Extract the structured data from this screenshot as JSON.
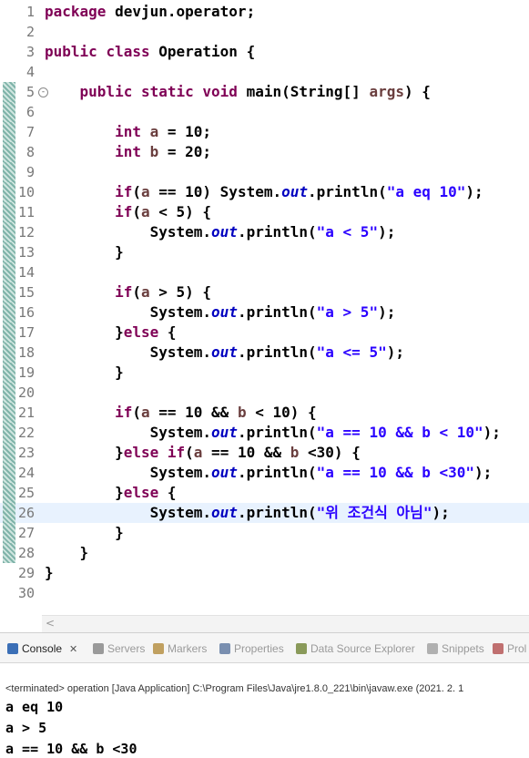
{
  "editor": {
    "lines": [
      {
        "n": "1",
        "html": "<span class='kw'>package</span> devjun.operator;"
      },
      {
        "n": "2",
        "html": ""
      },
      {
        "n": "3",
        "html": "<span class='kw'>public</span> <span class='kw'>class</span> Operation {"
      },
      {
        "n": "4",
        "html": ""
      },
      {
        "n": "5",
        "html": "    <span class='kw'>public</span> <span class='kw'>static</span> <span class='kw'>void</span> main(String[] <span class='var'>args</span>) {"
      },
      {
        "n": "6",
        "html": ""
      },
      {
        "n": "7",
        "html": "        <span class='kw'>int</span> <span class='var'>a</span> = 10;"
      },
      {
        "n": "8",
        "html": "        <span class='kw'>int</span> <span class='var'>b</span> = 20;"
      },
      {
        "n": "9",
        "html": ""
      },
      {
        "n": "10",
        "html": "        <span class='kw'>if</span>(<span class='var'>a</span> == 10) System.<span class='fld'>out</span>.println(<span class='str'>\"a eq 10\"</span>);"
      },
      {
        "n": "11",
        "html": "        <span class='kw'>if</span>(<span class='var'>a</span> &lt; 5) {"
      },
      {
        "n": "12",
        "html": "            System.<span class='fld'>out</span>.println(<span class='str'>\"a &lt; 5\"</span>);"
      },
      {
        "n": "13",
        "html": "        }"
      },
      {
        "n": "14",
        "html": ""
      },
      {
        "n": "15",
        "html": "        <span class='kw'>if</span>(<span class='var'>a</span> &gt; 5) {"
      },
      {
        "n": "16",
        "html": "            System.<span class='fld'>out</span>.println(<span class='str'>\"a &gt; 5\"</span>);"
      },
      {
        "n": "17",
        "html": "        }<span class='kw'>else</span> {"
      },
      {
        "n": "18",
        "html": "            System.<span class='fld'>out</span>.println(<span class='str'>\"a &lt;= 5\"</span>);"
      },
      {
        "n": "19",
        "html": "        }"
      },
      {
        "n": "20",
        "html": ""
      },
      {
        "n": "21",
        "html": "        <span class='kw'>if</span>(<span class='var'>a</span> == 10 &amp;&amp; <span class='var'>b</span> &lt; 10) {"
      },
      {
        "n": "22",
        "html": "            System.<span class='fld'>out</span>.println(<span class='str'>\"a == 10 &amp;&amp; b &lt; 10\"</span>);"
      },
      {
        "n": "23",
        "html": "        }<span class='kw'>else</span> <span class='kw'>if</span>(<span class='var'>a</span> == 10 &amp;&amp; <span class='var'>b</span> &lt;30) {"
      },
      {
        "n": "24",
        "html": "            System.<span class='fld'>out</span>.println(<span class='str'>\"a == 10 &amp;&amp; b &lt;30\"</span>);"
      },
      {
        "n": "25",
        "html": "        }<span class='kw'>else</span> {"
      },
      {
        "n": "26",
        "html": "            System.<span class='fld'>out</span>.println(<span class='str'>\"위 조건식 아님\"</span>);"
      },
      {
        "n": "27",
        "html": "        }"
      },
      {
        "n": "28",
        "html": "    }"
      },
      {
        "n": "29",
        "html": "}"
      },
      {
        "n": "30",
        "html": ""
      }
    ],
    "current_line": "26",
    "fold_marker_line": "5",
    "fold_symbol": "⊖",
    "change_marker_lines": [
      "5",
      "6",
      "7",
      "8",
      "9",
      "10",
      "11",
      "12",
      "13",
      "14",
      "15",
      "16",
      "17",
      "18",
      "19",
      "20",
      "21",
      "22",
      "23",
      "24",
      "25",
      "26",
      "27",
      "28"
    ],
    "scroll_left_arrow": "<"
  },
  "views": {
    "tabs": [
      {
        "label": "Console",
        "icon": "console-icon",
        "active": true,
        "close": "✕"
      },
      {
        "label": "Servers",
        "icon": "servers-icon",
        "active": false
      },
      {
        "label": "Markers",
        "icon": "markers-icon",
        "active": false
      },
      {
        "label": "Properties",
        "icon": "properties-icon",
        "active": false
      },
      {
        "label": "Data Source Explorer",
        "icon": "data-source-icon",
        "active": false
      },
      {
        "label": "Snippets",
        "icon": "snippets-icon",
        "active": false
      },
      {
        "label": "Prol",
        "icon": "problems-icon",
        "active": false
      }
    ],
    "status": "<terminated> operation [Java Application] C:\\Program Files\\Java\\jre1.8.0_221\\bin\\javaw.exe (2021. 2. 1",
    "output": [
      "a eq 10",
      "a > 5",
      "a == 10 && b <30"
    ]
  }
}
